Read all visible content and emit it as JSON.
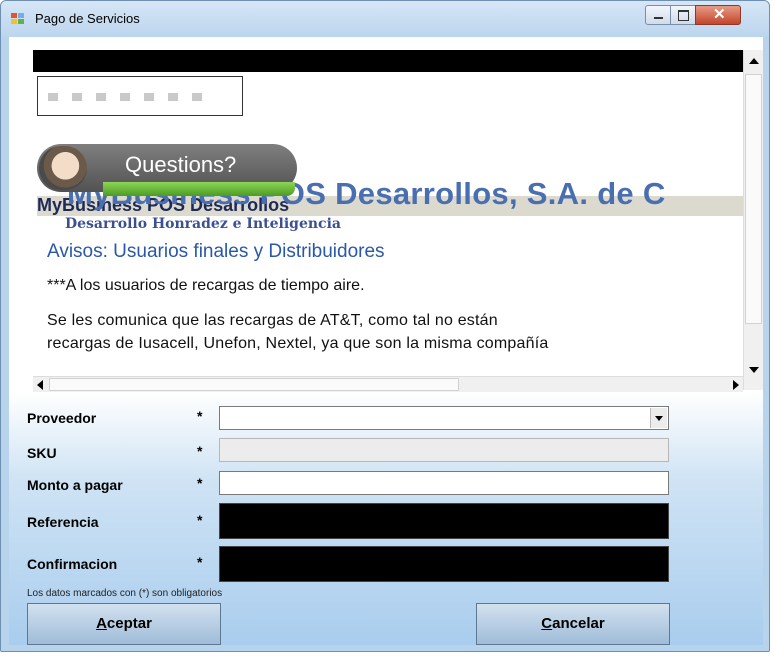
{
  "window": {
    "title": "Pago de Servicios",
    "accent": "#b8d3ec"
  },
  "browser": {
    "company": "MyBusiness POS Desarrollos, S.A. de C",
    "business_line": "MyBusiness POS Desarrollos",
    "motto": "Desarrollo Honradez e Inteligencia",
    "heading": "Avisos: Usuarios finales y Distribuidores",
    "notice_title": "***A los usuarios de recargas de tiempo aire.",
    "notice_line_1": "Se les comunica que las recargas de AT&T, como tal no están",
    "notice_line_2": "recargas de Iusacell, Unefon, Nextel, ya que son la misma compañía",
    "help_badge": "Questions?"
  },
  "form": {
    "proveedor": {
      "label": "Proveedor",
      "required": "*",
      "value": ""
    },
    "sku": {
      "label": "SKU",
      "required": "*",
      "value": ""
    },
    "monto": {
      "label": "Monto a pagar",
      "required": "*",
      "value": ""
    },
    "referencia": {
      "label": "Referencia",
      "required": "*",
      "value": ""
    },
    "confirmacion": {
      "label": "Confirmacion",
      "required": "*",
      "value": ""
    },
    "note": "Los datos marcados con (*) son obligatorios"
  },
  "buttons": {
    "accept_mnemonic": "A",
    "accept_rest": "ceptar",
    "cancel_mnemonic": "C",
    "cancel_rest": "ancelar"
  },
  "icons": [
    "app-icon",
    "minimize-icon",
    "maximize-icon",
    "close-icon",
    "dropdown-arrow-icon",
    "scroll-up-icon",
    "scroll-down-icon",
    "scroll-left-icon",
    "scroll-right-icon"
  ]
}
